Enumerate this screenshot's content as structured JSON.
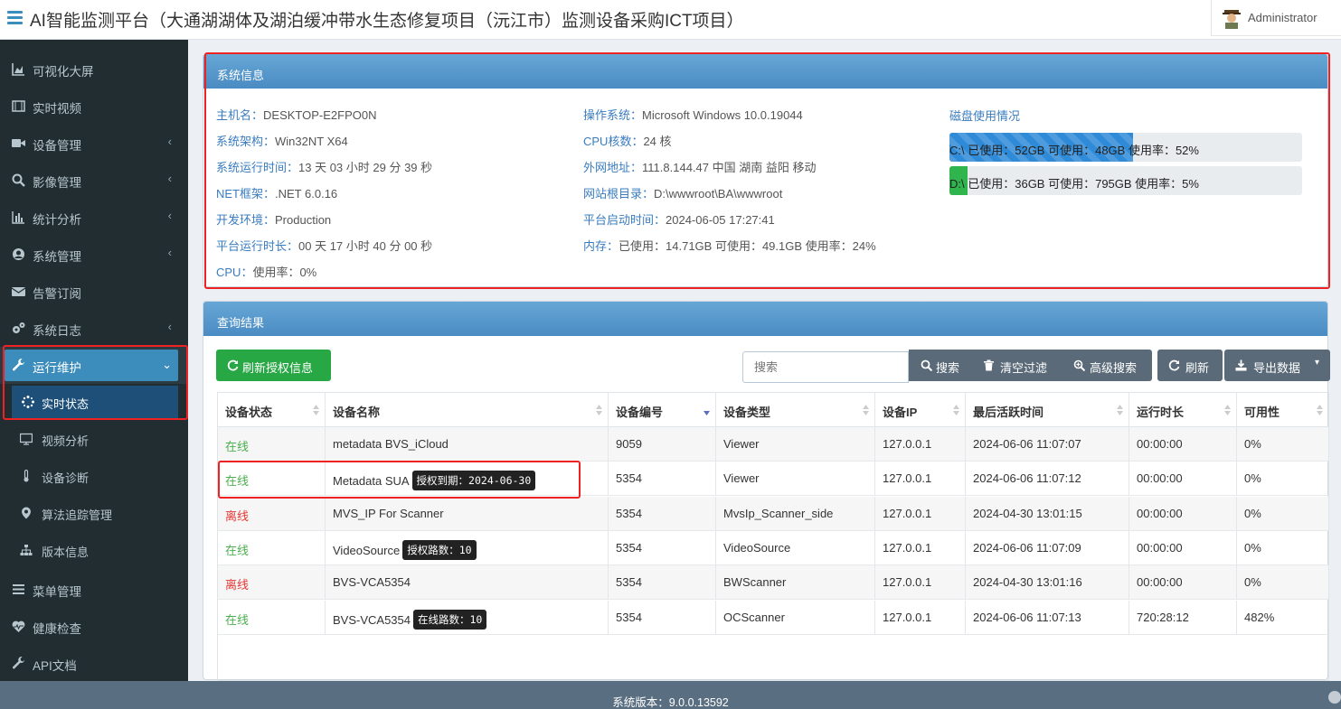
{
  "header": {
    "title": "AI智能监测平台（大通湖湖体及湖泊缓冲带水生态修复项目（沅江市）监测设备采购ICT项目）",
    "user": "Administrator"
  },
  "sidebar": {
    "items": [
      {
        "label": "可视化大屏",
        "icon": "area-chart-icon"
      },
      {
        "label": "实时视频",
        "icon": "film-icon"
      },
      {
        "label": "设备管理",
        "icon": "video-camera-icon"
      },
      {
        "label": "影像管理",
        "icon": "search-icon"
      },
      {
        "label": "统计分析",
        "icon": "bar-chart-icon"
      },
      {
        "label": "系统管理",
        "icon": "user-circle-icon"
      },
      {
        "label": "告警订阅",
        "icon": "envelope-icon"
      },
      {
        "label": "系统日志",
        "icon": "gears-icon"
      },
      {
        "label": "运行维护",
        "icon": "wrench-icon"
      },
      {
        "label": "菜单管理",
        "icon": "list-icon"
      },
      {
        "label": "健康检查",
        "icon": "heartbeat-icon"
      },
      {
        "label": "API文档",
        "icon": "wrench-icon"
      }
    ],
    "subitems": [
      {
        "label": "实时状态",
        "icon": "spinner-icon"
      },
      {
        "label": "视频分析",
        "icon": "desktop-icon"
      },
      {
        "label": "设备诊断",
        "icon": "thermometer-icon"
      },
      {
        "label": "算法追踪管理",
        "icon": "map-marker-icon"
      },
      {
        "label": "版本信息",
        "icon": "sitemap-icon"
      }
    ]
  },
  "system_info": {
    "title": "系统信息",
    "col1": [
      {
        "k": "主机名：",
        "v": "DESKTOP-E2FPO0N"
      },
      {
        "k": "系统架构：",
        "v": "Win32NT X64"
      },
      {
        "k": "系统运行时间：",
        "v": "13 天 03 小时 29 分 39 秒"
      },
      {
        "k": "NET框架：",
        "v": ".NET 6.0.16"
      },
      {
        "k": "开发环境：",
        "v": "Production"
      },
      {
        "k": "平台运行时长：",
        "v": "00 天 17 小时 40 分 00 秒"
      },
      {
        "k": "CPU：",
        "v": "使用率：0%"
      }
    ],
    "col2": [
      {
        "k": "操作系统：",
        "v": "Microsoft Windows 10.0.19044"
      },
      {
        "k": "CPU核数：",
        "v": "24 核"
      },
      {
        "k": "外网地址：",
        "v": "111.8.144.47 中国 湖南 益阳 移动"
      },
      {
        "k": "网站根目录：",
        "v": "D:\\wwwroot\\BA\\wwwroot"
      },
      {
        "k": "平台启动时间：",
        "v": "2024-06-05 17:27:41"
      },
      {
        "k": "内存：",
        "v": "已使用：14.71GB  可使用：49.1GB  使用率：24%"
      }
    ],
    "disk_title": "磁盘使用情况",
    "disks": [
      {
        "drive": "C:\\",
        "text": "  已使用：52GB  可使用：48GB  使用率：52%",
        "usage": 0.52,
        "color": "#2f8bd8"
      },
      {
        "drive": "D:\\",
        "text": "  已使用：36GB  可使用：795GB  使用率：5%",
        "usage": 0.05,
        "color": "#2fb44e"
      }
    ]
  },
  "results": {
    "title": "查询结果",
    "refresh_license": "刷新授权信息",
    "search_placeholder": "搜索",
    "search_btn": "搜索",
    "clear_btn": "清空过滤",
    "advanced_btn": "高级搜索",
    "refresh_btn": "刷新",
    "export_btn": "导出数据",
    "columns": [
      "设备状态",
      "设备名称",
      "设备编号",
      "设备类型",
      "设备IP",
      "最后活跃时间",
      "运行时长",
      "可用性"
    ],
    "rows": [
      {
        "status": "在线",
        "online": true,
        "name": "metadata BVS_iCloud",
        "tag": "",
        "no": "9059",
        "type": "Viewer",
        "ip": "127.0.0.1",
        "last": "2024-06-06 11:07:07",
        "dur": "00:00:00",
        "avail": "0%"
      },
      {
        "status": "在线",
        "online": true,
        "name": "Metadata SUA",
        "tag": "授权到期：2024-06-30",
        "no": "5354",
        "type": "Viewer",
        "ip": "127.0.0.1",
        "last": "2024-06-06 11:07:12",
        "dur": "00:00:00",
        "avail": "0%"
      },
      {
        "status": "离线",
        "online": false,
        "name": "MVS_IP For Scanner",
        "tag": "",
        "no": "5354",
        "type": "MvsIp_Scanner_side",
        "ip": "127.0.0.1",
        "last": "2024-04-30 13:01:15",
        "dur": "00:00:00",
        "avail": "0%"
      },
      {
        "status": "在线",
        "online": true,
        "name": "VideoSource",
        "tag": "授权路数：10",
        "no": "5354",
        "type": "VideoSource",
        "ip": "127.0.0.1",
        "last": "2024-06-06 11:07:09",
        "dur": "00:00:00",
        "avail": "0%"
      },
      {
        "status": "离线",
        "online": false,
        "name": "BVS-VCA5354",
        "tag": "",
        "no": "5354",
        "type": "BWScanner",
        "ip": "127.0.0.1",
        "last": "2024-04-30 13:01:16",
        "dur": "00:00:00",
        "avail": "0%"
      },
      {
        "status": "在线",
        "online": true,
        "name": "BVS-VCA5354",
        "tag": "在线路数：10",
        "no": "5354",
        "type": "OCScanner",
        "ip": "127.0.0.1",
        "last": "2024-06-06 11:07:13",
        "dur": "720:28:12",
        "avail": "482%"
      }
    ]
  },
  "footer": {
    "version": "系统版本：9.0.0.13592"
  }
}
